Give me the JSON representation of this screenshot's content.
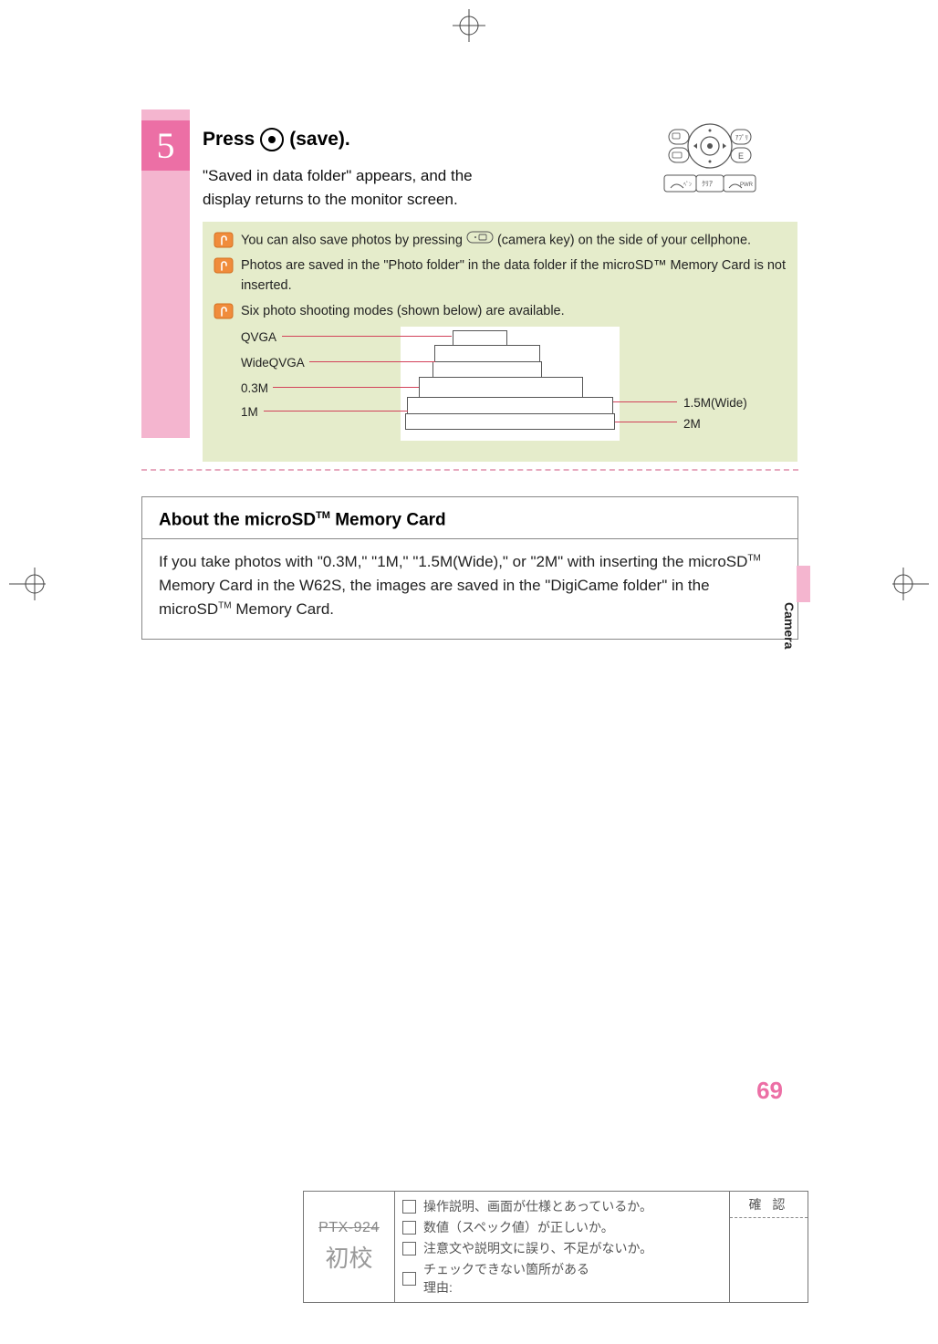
{
  "step": {
    "number": "5",
    "title_pre": "Press",
    "title_post": "(save).",
    "description": "\"Saved in data folder\" appears, and the display returns to the monitor screen."
  },
  "tips": {
    "tip1_a": "You can also save photos by pressing",
    "tip1_b": "(camera key) on the side of your cellphone.",
    "tip2": "Photos are saved in the \"Photo folder\" in the data folder if the microSD™ Memory Card is not inserted.",
    "tip3": "Six photo shooting modes (shown below) are available."
  },
  "modes": {
    "qvga": "QVGA",
    "wideqvga": "WideQVGA",
    "m03": "0.3M",
    "m1": "1M",
    "m15wide": "1.5M(Wide)",
    "m2": "2M"
  },
  "about": {
    "heading_pre": "About the microSD",
    "heading_sup": "TM",
    "heading_post": " Memory Card",
    "body_1": "If you take photos with \"0.3M,\" \"1M,\" \"1.5M(Wide),\" or \"2M\" with inserting the microSD",
    "body_2": " Memory Card in the W62S, the images are saved in the \"DigiCame folder\" in the microSD",
    "body_3": " Memory Card."
  },
  "sideLabel": "Camera",
  "pageNumber": "69",
  "proof": {
    "ptx": "PTX-924",
    "shokou": "初校",
    "check1": "操作説明、画面が仕様とあっているか。",
    "check2": "数値（スペック値）が正しいか。",
    "check3": "注意文や説明文に誤り、不足がないか。",
    "check4a": "チェックできない箇所がある",
    "check4b": "理由:",
    "kakunin": "確 認"
  }
}
